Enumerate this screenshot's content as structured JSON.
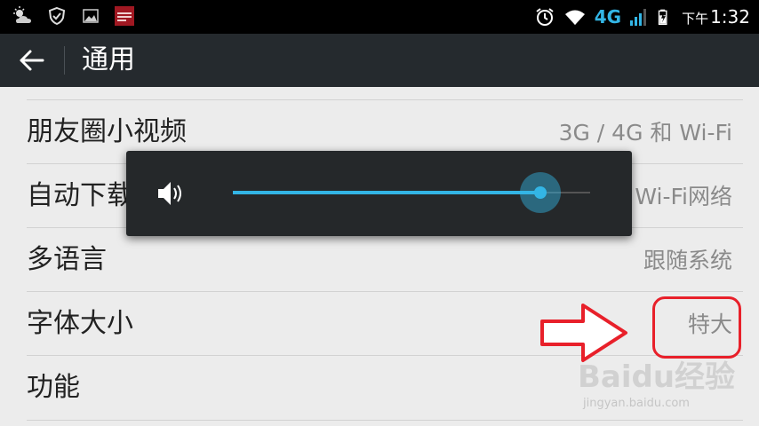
{
  "status_bar": {
    "time_prefix": "下午",
    "time": "1:32",
    "network": "4G",
    "icons": [
      "weather-icon",
      "shield-check-icon",
      "image-icon",
      "app-badge-icon",
      "alarm-icon",
      "wifi-icon",
      "signal-icon",
      "battery-icon"
    ]
  },
  "action_bar": {
    "title": "通用",
    "back_icon": "back-arrow-icon"
  },
  "settings": {
    "items": [
      {
        "label": "朋友圈小视频",
        "value": "3G / 4G 和 Wi-Fi"
      },
      {
        "label": "自动下载",
        "value": "Wi-Fi网络"
      },
      {
        "label": "多语言",
        "value": "跟随系统"
      },
      {
        "label": "字体大小",
        "value": "特大"
      },
      {
        "label": "功能",
        "value": ""
      }
    ]
  },
  "volume_dialog": {
    "icon": "speaker-icon",
    "level": 0.86,
    "accent_color": "#33b5e5"
  },
  "annotation": {
    "arrow_color": "#e8202a",
    "box_color": "#e8202a"
  },
  "watermark": {
    "logo": "Baidu经验",
    "url": "jingyan.baidu.com"
  }
}
